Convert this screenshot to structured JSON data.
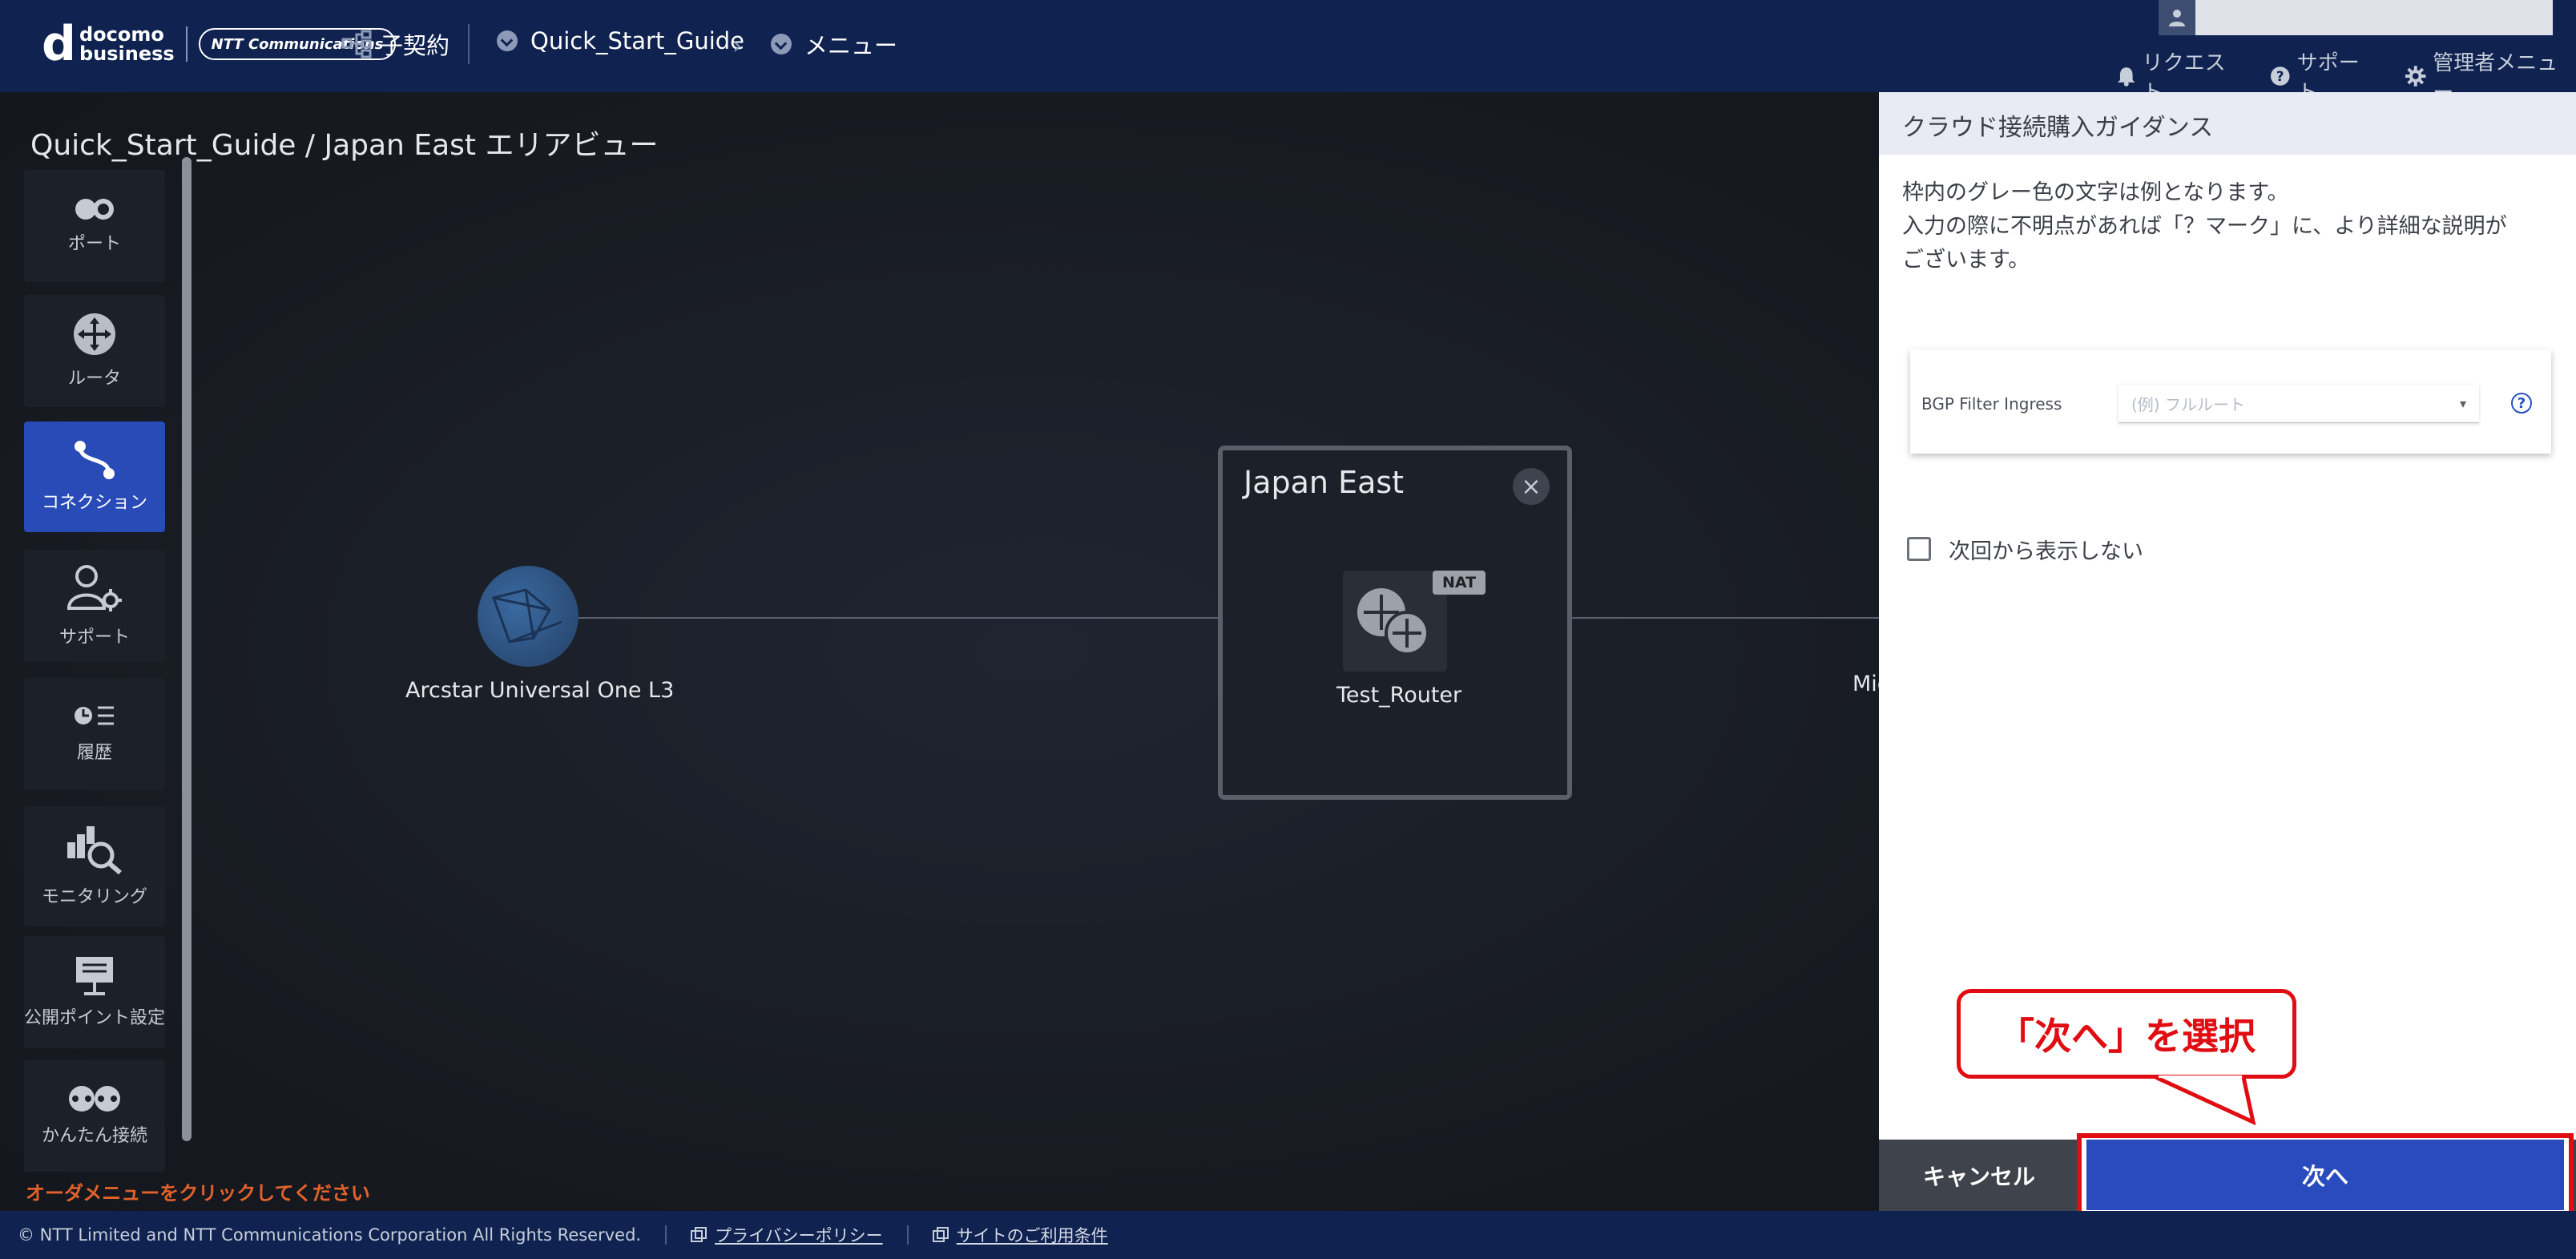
{
  "header": {
    "logo": {
      "d": "d",
      "docomo": "docomo",
      "business": "business",
      "ntt": "NTT Communications"
    },
    "breadcrumbs": {
      "subcontract": "子契約",
      "guide": "Quick_Start_Guide",
      "menu": "メニュー"
    },
    "top_links": {
      "request": "リクエスト",
      "support": "サポート",
      "admin": "管理者メニュー"
    },
    "user_name": ""
  },
  "page_title": "Quick_Start_Guide / Japan East エリアビュー",
  "sidebar": {
    "items": [
      {
        "label": "ポート",
        "icon": "port-icon"
      },
      {
        "label": "ルータ",
        "icon": "router-icon"
      },
      {
        "label": "コネクション",
        "icon": "connection-icon"
      },
      {
        "label": "サポート",
        "icon": "support-user-icon"
      },
      {
        "label": "履歴",
        "icon": "history-icon"
      },
      {
        "label": "モニタリング",
        "icon": "monitoring-icon"
      },
      {
        "label": "公開ポイント設定",
        "icon": "public-point-icon"
      },
      {
        "label": "かんたん接続",
        "icon": "easy-connect-icon"
      }
    ],
    "active_index": 2
  },
  "order_hint": "オーダメニューをクリックしてください",
  "canvas": {
    "arcstar_label": "Arcstar Universal One L3",
    "area_title": "Japan East",
    "router_label": "Test_Router",
    "nat_badge": "NAT",
    "ms_label_partial": "Mic"
  },
  "panel": {
    "title": "クラウド接続購入ガイダンス",
    "desc_line1": "枠内のグレー色の文字は例となります。",
    "desc_line2": "入力の際に不明点があれば「？マーク」に、より詳細な説明が",
    "desc_line3": "ございます。",
    "bgp_label": "BGP Filter Ingress",
    "bgp_placeholder": "(例) フルルート",
    "help_mark": "?",
    "checkbox_label": "次回から表示しない",
    "callout": "「次へ」を選択",
    "cancel": "キャンセル",
    "next": "次へ"
  },
  "footer": {
    "copyright": "© NTT Limited and NTT Communications Corporation All Rights Reserved.",
    "privacy": "プライバシーポリシー",
    "terms": "サイトのご利用条件"
  },
  "colors": {
    "header_bg": "#0f2250",
    "accent": "#2a4bbd",
    "highlight": "#e00d12",
    "hint": "#e4622a"
  }
}
